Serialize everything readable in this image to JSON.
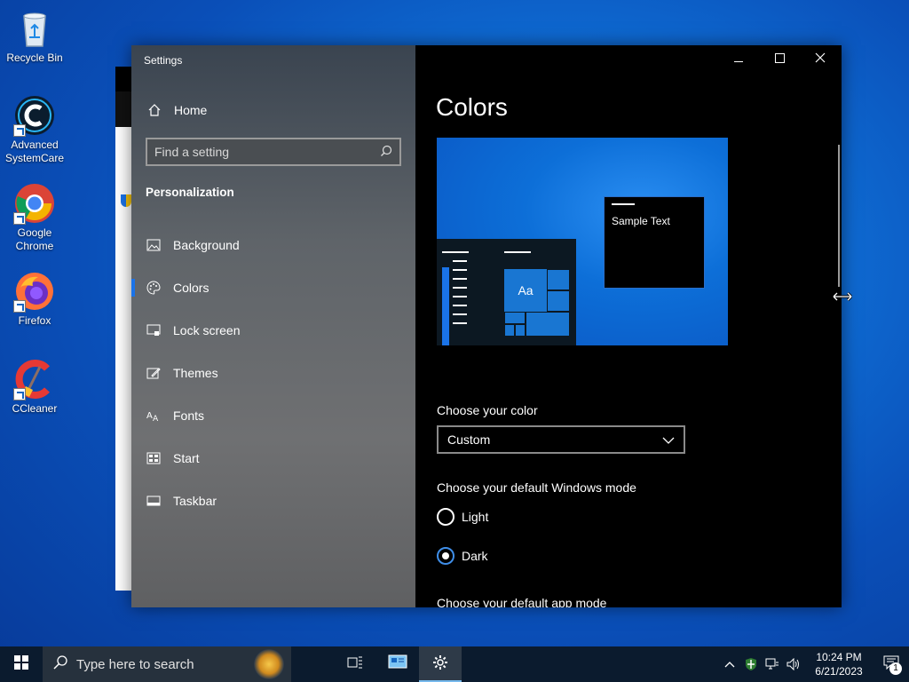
{
  "desktop": {
    "icons": [
      {
        "label": "Recycle Bin",
        "icon": "recycle-bin-icon"
      },
      {
        "label": "Advanced SystemCare",
        "icon": "advanced-systemcare-icon"
      },
      {
        "label": "Google Chrome",
        "icon": "chrome-icon"
      },
      {
        "label": "Firefox",
        "icon": "firefox-icon"
      },
      {
        "label": "CCleaner",
        "icon": "ccleaner-icon"
      }
    ]
  },
  "settings": {
    "app_title": "Settings",
    "home_label": "Home",
    "search_placeholder": "Find a setting",
    "section_heading": "Personalization",
    "nav_items": [
      {
        "label": "Background",
        "icon": "picture-icon"
      },
      {
        "label": "Colors",
        "icon": "palette-icon",
        "active": true
      },
      {
        "label": "Lock screen",
        "icon": "lock-screen-icon"
      },
      {
        "label": "Themes",
        "icon": "themes-icon"
      },
      {
        "label": "Fonts",
        "icon": "fonts-icon"
      },
      {
        "label": "Start",
        "icon": "start-icon"
      },
      {
        "label": "Taskbar",
        "icon": "taskbar-icon"
      }
    ],
    "content": {
      "title": "Colors",
      "preview": {
        "sample_text": "Sample Text",
        "tile_text": "Aa"
      },
      "choose_color_label": "Choose your color",
      "color_dropdown_value": "Custom",
      "windows_mode_label": "Choose your default Windows mode",
      "windows_mode_options": [
        {
          "label": "Light",
          "checked": false
        },
        {
          "label": "Dark",
          "checked": true
        }
      ],
      "app_mode_label": "Choose your default app mode"
    },
    "accent_color": "#1a73e8"
  },
  "taskbar": {
    "search_placeholder": "Type here to search",
    "clock_time": "10:24 PM",
    "clock_date": "6/21/2023",
    "notification_count": "1"
  }
}
